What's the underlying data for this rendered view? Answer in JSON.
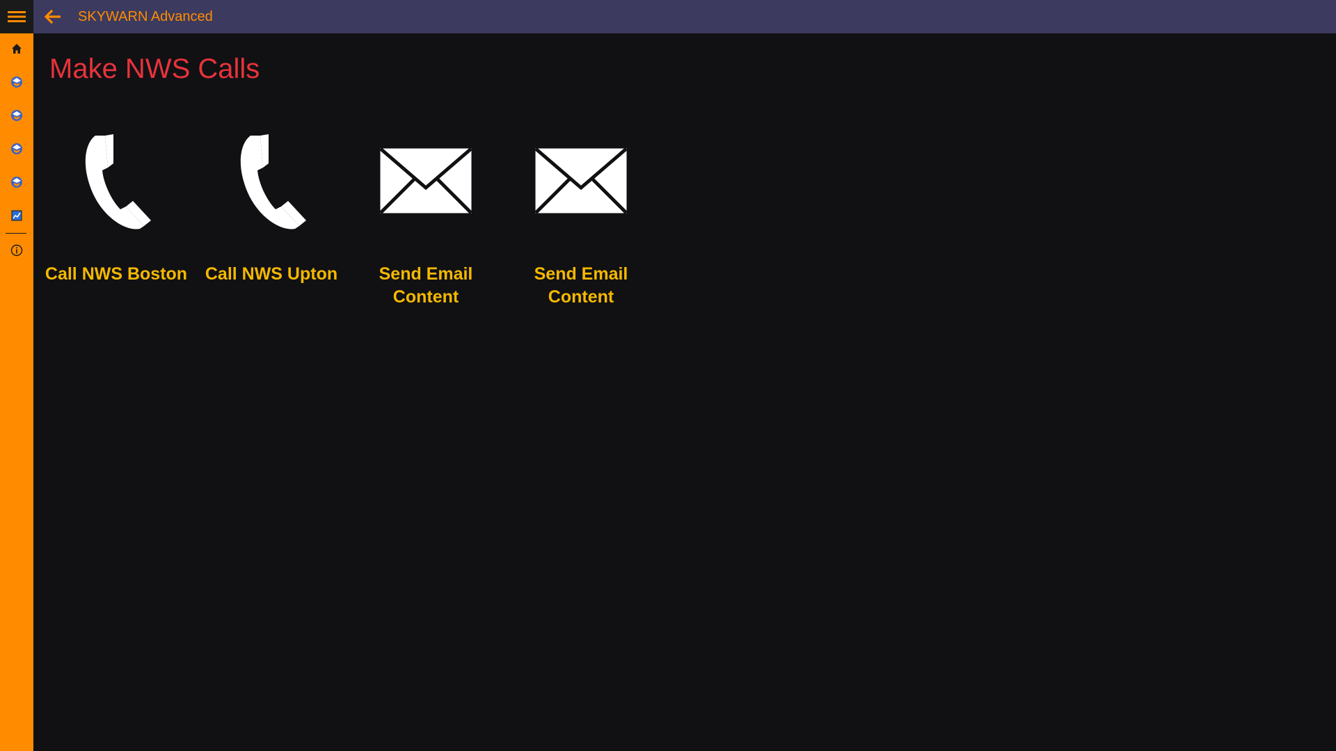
{
  "app": {
    "title": "SKYWARN Advanced"
  },
  "sidebar": {
    "items": [
      {
        "icon": "home-icon"
      },
      {
        "icon": "skywarn-logo-icon"
      },
      {
        "icon": "skywarn-logo-icon"
      },
      {
        "icon": "skywarn-logo-icon"
      },
      {
        "icon": "skywarn-logo-icon"
      },
      {
        "icon": "chart-icon"
      },
      {
        "icon": "info-icon"
      }
    ]
  },
  "page": {
    "title": "Make NWS Calls"
  },
  "tiles": [
    {
      "label": "Call NWS Boston",
      "icon": "phone-icon"
    },
    {
      "label": "Call NWS Upton",
      "icon": "phone-icon"
    },
    {
      "label": "Send Email Content",
      "icon": "envelope-icon"
    },
    {
      "label": "Send Email Content",
      "icon": "envelope-icon"
    }
  ],
  "colors": {
    "sidebar": "#ff8c00",
    "topbar": "#3c3a5e",
    "background": "#111113",
    "page_title": "#e8333c",
    "tile_label": "#f5b800"
  }
}
